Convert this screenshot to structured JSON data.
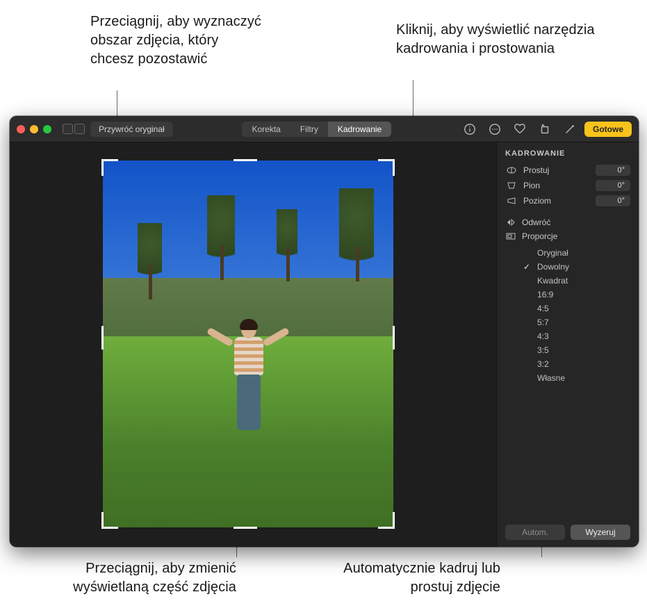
{
  "callouts": {
    "top_left": "Przeciągnij, aby wyznaczyć obszar zdjęcia, który chcesz pozostawić",
    "top_right": "Kliknij, aby wyświetlić narzędzia kadrowania i prostowania",
    "bottom_left": "Przeciągnij, aby zmienić wyświetlaną część zdjęcia",
    "bottom_right": "Automatycznie kadruj lub prostuj zdjęcie"
  },
  "toolbar": {
    "revert_label": "Przywróć oryginał",
    "tabs": {
      "adjust": "Korekta",
      "filters": "Filtry",
      "crop": "Kadrowanie"
    },
    "done_label": "Gotowe"
  },
  "sidebar": {
    "header": "KADROWANIE",
    "straighten": {
      "label": "Prostuj",
      "value": "0°"
    },
    "vertical": {
      "label": "Pion",
      "value": "0°"
    },
    "horizontal": {
      "label": "Poziom",
      "value": "0°"
    },
    "flip_label": "Odwróć",
    "aspect_label": "Proporcje",
    "aspect_items": [
      {
        "label": "Oryginał",
        "checked": false
      },
      {
        "label": "Dowolny",
        "checked": true
      },
      {
        "label": "Kwadrat",
        "checked": false
      },
      {
        "label": "16:9",
        "checked": false
      },
      {
        "label": "4:5",
        "checked": false
      },
      {
        "label": "5:7",
        "checked": false
      },
      {
        "label": "4:3",
        "checked": false
      },
      {
        "label": "3:5",
        "checked": false
      },
      {
        "label": "3:2",
        "checked": false
      },
      {
        "label": "Własne",
        "checked": false
      }
    ],
    "auto_label": "Autom.",
    "reset_label": "Wyzeruj"
  }
}
